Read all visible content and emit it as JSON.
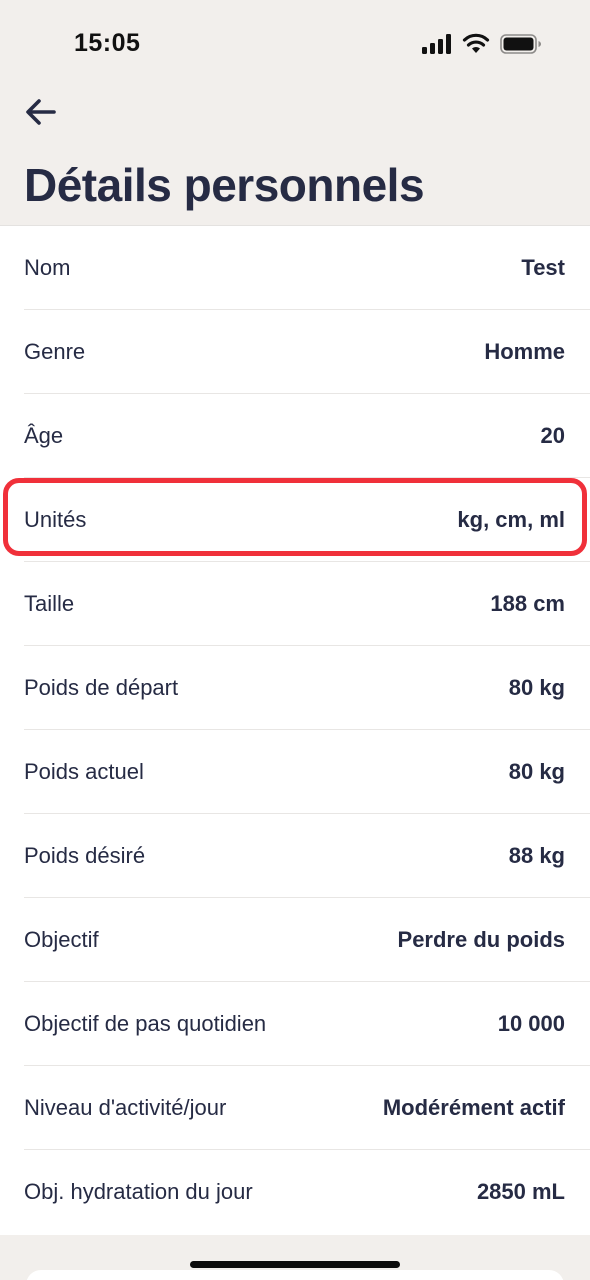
{
  "status_bar": {
    "time": "15:05",
    "icons": [
      "signal-icon",
      "wifi-icon",
      "battery-icon"
    ]
  },
  "header": {
    "back_icon": "arrow-left-icon",
    "title": "Détails personnels"
  },
  "colors": {
    "text": "#262b44",
    "background": "#f2efec",
    "card": "#ffffff",
    "highlight": "#f0303a"
  },
  "details": [
    {
      "label": "Nom",
      "value": "Test"
    },
    {
      "label": "Genre",
      "value": "Homme"
    },
    {
      "label": "Âge",
      "value": "20"
    },
    {
      "label": "Unités",
      "value": "kg, cm, ml"
    },
    {
      "label": "Taille",
      "value": "188 cm"
    },
    {
      "label": "Poids de départ",
      "value": "80 kg"
    },
    {
      "label": "Poids actuel",
      "value": "80 kg"
    },
    {
      "label": "Poids désiré",
      "value": "88 kg"
    },
    {
      "label": "Objectif",
      "value": "Perdre du poids"
    },
    {
      "label": "Objectif de pas quotidien",
      "value": "10 000"
    },
    {
      "label": "Niveau d'activité/jour",
      "value": "Modérément actif"
    },
    {
      "label": "Obj. hydratation du jour",
      "value": "2850 mL"
    }
  ]
}
